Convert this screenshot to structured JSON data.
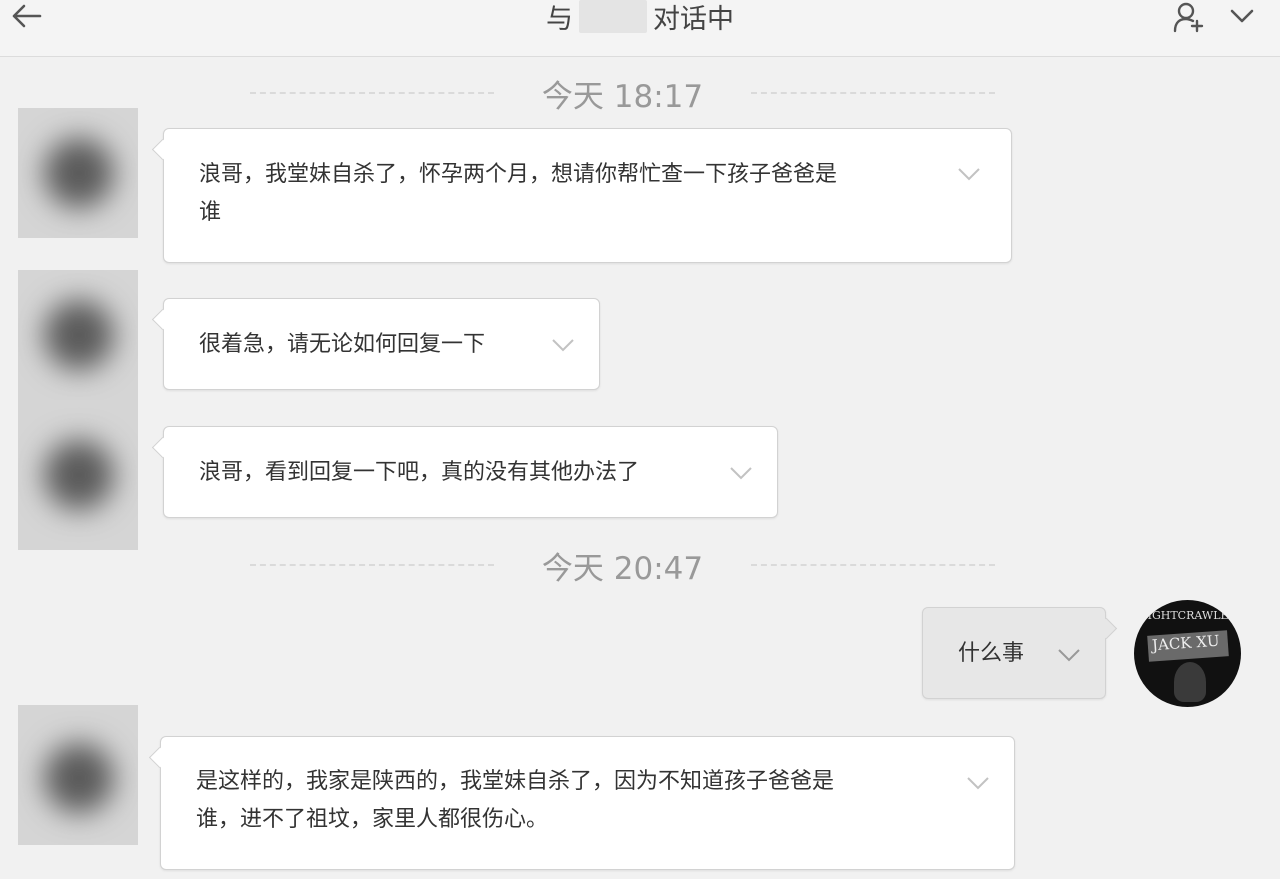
{
  "header": {
    "title_prefix": "与",
    "title_suffix": "对话中"
  },
  "timestamps": [
    "今天 18:17",
    "今天 20:47"
  ],
  "messages": [
    {
      "text_lines": [
        "浪哥，我堂妹自杀了，怀孕两个月，想请你帮忙查一下孩子爸爸是",
        "谁"
      ]
    },
    {
      "text_lines": [
        "很着急，请无论如何回复一下"
      ]
    },
    {
      "text_lines": [
        "浪哥，看到回复一下吧，真的没有其他办法了"
      ]
    },
    {
      "text_lines": [
        "什么事"
      ]
    },
    {
      "text_lines": [
        "是这样的，我家是陕西的，我堂妹自杀了，因为不知道孩子爸爸是",
        "谁，进不了祖坟，家里人都很伤心。"
      ]
    }
  ],
  "my_avatar": {
    "top_text": "NIGHTCRAWLER",
    "tag_text": "JACK XU"
  },
  "colors": {
    "background": "#f1f1f1",
    "incoming_bubble": "#ffffff",
    "outgoing_bubble": "#e7e7e7",
    "timestamp_text": "#999999"
  },
  "icons": [
    "back-arrow-icon",
    "add-user-icon",
    "chevron-down-icon"
  ]
}
